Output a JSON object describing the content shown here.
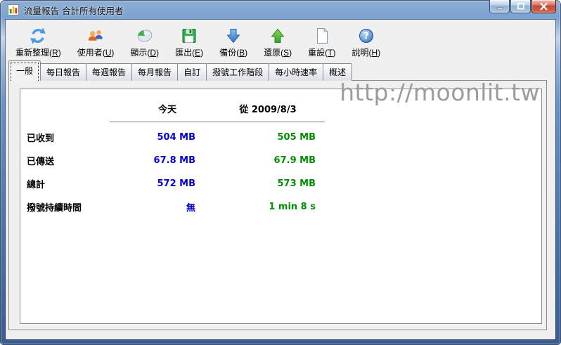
{
  "window": {
    "title": "流量報告 合計所有使用者"
  },
  "watermark": "http://moonlit.tw",
  "toolbar": {
    "accel_open": "(",
    "accel_close": ")",
    "items": [
      {
        "name": "refresh",
        "icon": "refresh-icon",
        "label": "重新整理",
        "key": "R"
      },
      {
        "name": "users",
        "icon": "users-icon",
        "label": "使用者",
        "key": "U"
      },
      {
        "name": "display",
        "icon": "display-icon",
        "label": "顯示",
        "key": "D"
      },
      {
        "name": "export",
        "icon": "export-icon",
        "label": "匯出",
        "key": "E"
      },
      {
        "name": "backup",
        "icon": "backup-icon",
        "label": "備份",
        "key": "B"
      },
      {
        "name": "restore",
        "icon": "restore-icon",
        "label": "還原",
        "key": "S"
      },
      {
        "name": "reset",
        "icon": "reset-icon",
        "label": "重設",
        "key": "T"
      },
      {
        "name": "help",
        "icon": "help-icon",
        "label": "說明",
        "key": "H"
      }
    ]
  },
  "tabs": {
    "items": [
      {
        "name": "general",
        "label": "一般",
        "selected": true
      },
      {
        "name": "daily-report",
        "label": "每日報告",
        "selected": false
      },
      {
        "name": "weekly-report",
        "label": "每週報告",
        "selected": false
      },
      {
        "name": "monthly-report",
        "label": "每月報告",
        "selected": false
      },
      {
        "name": "custom",
        "label": "自訂",
        "selected": false
      },
      {
        "name": "dialup-sessions",
        "label": "撥號工作階段",
        "selected": false
      },
      {
        "name": "hourly-rate",
        "label": "每小時速率",
        "selected": false
      },
      {
        "name": "summary",
        "label": "概述",
        "selected": false
      }
    ]
  },
  "report": {
    "headers": {
      "today": "今天",
      "since": "從 2009/8/3"
    },
    "colors": {
      "today_value": "#0000CC",
      "since_value": "#008F00"
    },
    "rows": [
      {
        "name": "received",
        "label": "已收到",
        "today": "504 MB",
        "since": "505 MB"
      },
      {
        "name": "sent",
        "label": "已傳送",
        "today": "67.8 MB",
        "since": "67.9 MB"
      },
      {
        "name": "total",
        "label": "總計",
        "today": "572 MB",
        "since": "573 MB"
      },
      {
        "name": "dialup-duration",
        "label": "撥號持續時間",
        "today": "無",
        "since": "1 min 8 s"
      }
    ]
  }
}
